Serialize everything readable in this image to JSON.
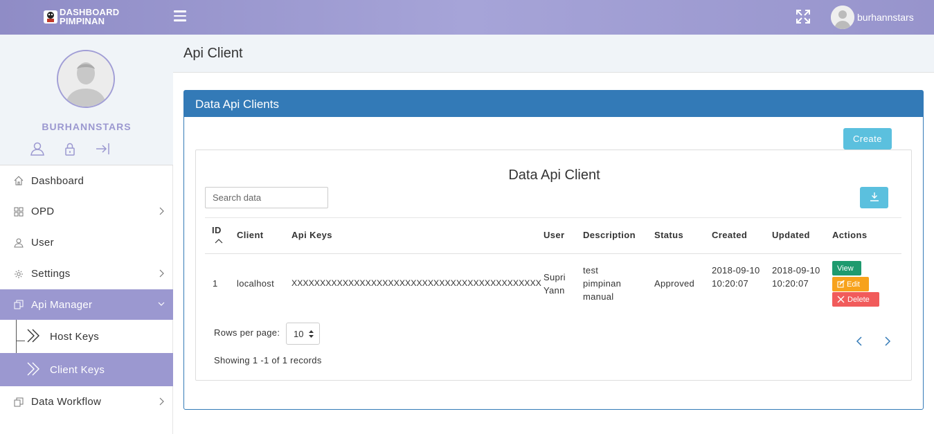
{
  "brand": {
    "line1": "DASHBOARD",
    "line2": "PIMPINAN"
  },
  "topbar": {
    "username": "burhannstars"
  },
  "profile": {
    "name": "BURHANNSTARS"
  },
  "menu": {
    "dashboard": "Dashboard",
    "opd": "OPD",
    "user": "User",
    "settings": "Settings",
    "api_manager": "Api Manager",
    "host_keys": "Host Keys",
    "client_keys": "Client Keys",
    "data_workflow": "Data Workflow"
  },
  "page": {
    "title": "Api Client"
  },
  "panel": {
    "heading": "Data Api Clients",
    "create_label": "Create"
  },
  "table": {
    "title": "Data Api Client",
    "search_placeholder": "Search data",
    "columns": [
      "ID",
      "Client",
      "Api Keys",
      "User",
      "Description",
      "Status",
      "Created",
      "Updated",
      "Actions"
    ],
    "rows": [
      {
        "id": "1",
        "client": "localhost",
        "api_key": "XXXXXXXXXXXXXXXXXXXXXXXXXXXXXXXXXXXXXXXXXXXX",
        "user": "Supri Yann",
        "description": "test pimpinan manual",
        "status": "Approved",
        "created": "2018-09-10 10:20:07",
        "updated": "2018-09-10 10:20:07",
        "actions": {
          "view": "View",
          "edit": "Edit",
          "delete": "Delete"
        }
      }
    ],
    "rows_per_page_label": "Rows per page:",
    "rows_per_page": "10",
    "showing": "Showing 1 -1 of 1 records"
  },
  "colors": {
    "topbar": "#9b98d0",
    "panel_primary": "#337ab7",
    "info_button": "#5bc0de",
    "view": "#1e9a6e",
    "edit": "#f7a21c",
    "delete": "#f15b5b"
  },
  "icons": {
    "menu": "hamburger-icon",
    "fullscreen": "expand-icon",
    "profile_actions": [
      "user-icon",
      "lock-icon",
      "logout-icon"
    ],
    "download": "download-icon",
    "sort": "sort-up-icon",
    "pager": [
      "chevron-left-icon",
      "chevron-right-icon"
    ]
  }
}
